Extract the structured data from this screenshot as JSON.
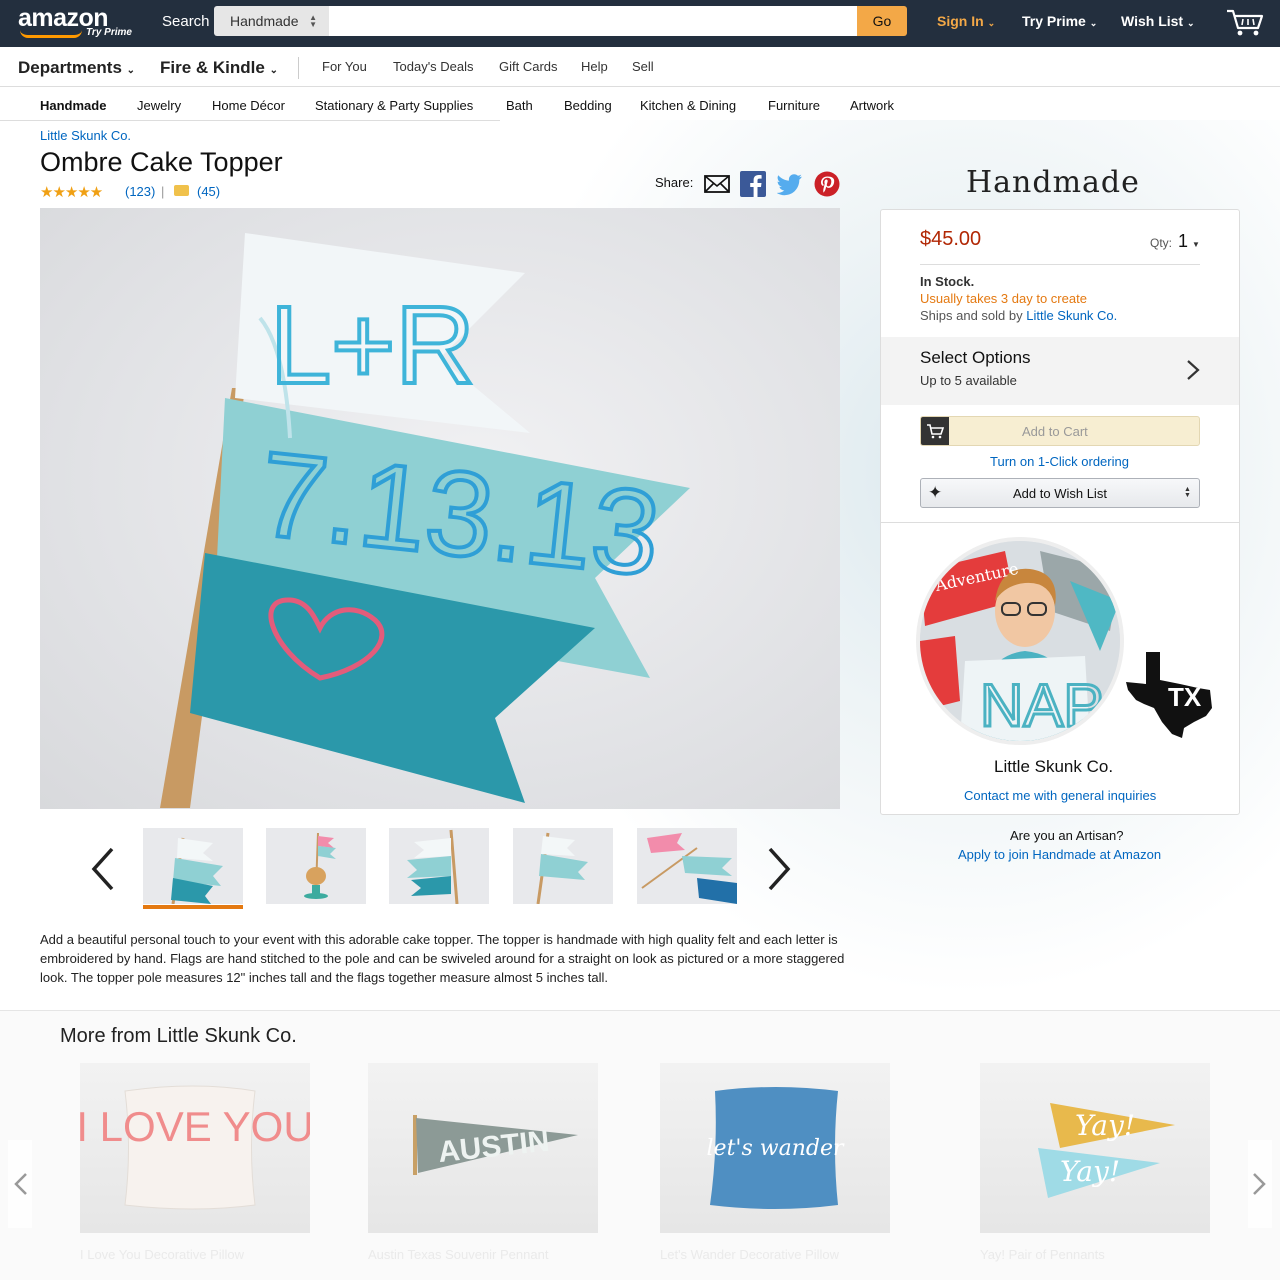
{
  "header": {
    "logo": "amazon",
    "logo_sub": "Try Prime",
    "search_label": "Search",
    "search_dept": "Handmade",
    "search_placeholder": "",
    "go": "Go",
    "signin": "Sign In",
    "try_prime": "Try Prime",
    "wish_list": "Wish List"
  },
  "nav": {
    "departments": "Departments",
    "fire_kindle": "Fire & Kindle",
    "links": [
      "For You",
      "Today's Deals",
      "Gift Cards",
      "Help",
      "Sell"
    ]
  },
  "categories": [
    "Handmade",
    "Jewelry",
    "Home Décor",
    "Stationary & Party Supplies",
    "Bath",
    "Bedding",
    "Kitchen & Dining",
    "Furniture",
    "Artwork"
  ],
  "product": {
    "brand": "Little Skunk Co.",
    "title": "Ombre Cake Topper",
    "stars": "★★★★★",
    "rating_count": "(123)",
    "pipe": "|",
    "question_count": "(45)",
    "share_label": "Share:",
    "image_flag1": "L+R",
    "image_flag2": "7.13.13",
    "rating": 4.5,
    "description": "Add a beautiful personal touch to your event with this adorable cake topper. The topper is handmade with high quality felt and each letter is embroidered by hand. Flags are hand stitched to the pole and can be swiveled around for a straight on look as pictured or a more staggered look. The topper pole measures 12\" inches tall and the flags together measure almost 5 inches tall."
  },
  "buybox": {
    "handmade_heading": "Handmade",
    "price": "$45.00",
    "qty_label": "Qty:",
    "qty_value": "1",
    "in_stock": "In Stock.",
    "usually": "Usually takes 3 day to create",
    "ships_prefix": "Ships and sold by ",
    "ships_seller": "Little Skunk Co.",
    "select_options": "Select Options",
    "options_sub": "Up to 5 available",
    "add_to_cart": "Add to Cart",
    "one_click": "Turn on 1-Click ordering",
    "add_wish": "Add to Wish List",
    "seller_name": "Little Skunk Co.",
    "contact": "Contact me with general inquiries",
    "avatar_banner": "Adventure",
    "state": "TX"
  },
  "artisan": {
    "question": "Are you an Artisan?",
    "apply": "Apply to join Handmade at Amazon"
  },
  "more": {
    "title": "More from Little Skunk Co.",
    "items": [
      {
        "caption": "I Love You Decorative Pillow",
        "art": "I LOVE YOU"
      },
      {
        "caption": "Austin Texas Souvenir Pennant",
        "art": "AUSTIN"
      },
      {
        "caption": "Let's Wander Decorative Pillow",
        "art": "let's wander"
      },
      {
        "caption": "Yay! Pair of Pennants",
        "art": "Yay!"
      }
    ]
  },
  "colors": {
    "topbar": "#232f3e",
    "accent_orange": "#f3a847",
    "price_red": "#b12704",
    "link_blue": "#0066c0",
    "orange_text": "#e47911"
  }
}
